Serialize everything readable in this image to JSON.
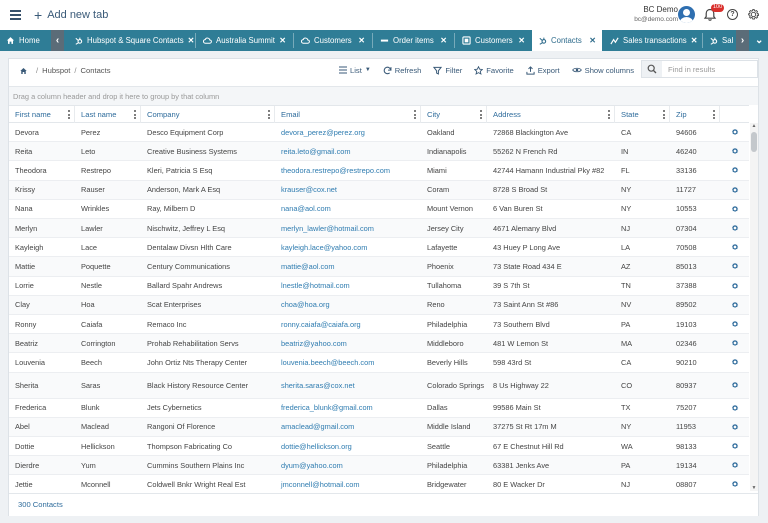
{
  "header": {
    "add_tab_label": "Add new tab",
    "user_name": "BC Demo",
    "user_email": "bc@demo.com",
    "notification_count": "100"
  },
  "tabs": [
    {
      "label": "Home",
      "icon": "home-icon"
    },
    {
      "label": "Hubspot & Square Contacts",
      "icon": "hubspot-icon"
    },
    {
      "label": "Australia Summit",
      "icon": "cloud-icon"
    },
    {
      "label": "Customers",
      "icon": "cloud-icon"
    },
    {
      "label": "Order items",
      "icon": "dash-icon"
    },
    {
      "label": "Customers",
      "icon": "box-icon"
    },
    {
      "label": "Contacts",
      "icon": "hubspot-icon",
      "active": true
    },
    {
      "label": "Sales transactions",
      "icon": "chart-icon"
    },
    {
      "label": "Sal",
      "icon": "hubspot-icon"
    }
  ],
  "breadcrumb": {
    "part1": "Hubspot",
    "part2": "Contacts"
  },
  "toolbar": {
    "list_label": "List",
    "refresh_label": "Refresh",
    "filter_label": "Filter",
    "favorite_label": "Favorite",
    "export_label": "Export",
    "show_columns_label": "Show columns",
    "search_placeholder": "Find in results"
  },
  "group_hint": "Drag a column header and drop it here to group by that column",
  "columns": [
    "First name",
    "Last name",
    "Company",
    "Email",
    "City",
    "Address",
    "State",
    "Zip"
  ],
  "rows": [
    [
      "Devora",
      "Perez",
      "Desco Equipment Corp",
      "devora_perez@perez.org",
      "Oakland",
      "72868 Blackington Ave",
      "CA",
      "94606"
    ],
    [
      "Reita",
      "Leto",
      "Creative Business Systems",
      "reita.leto@gmail.com",
      "Indianapolis",
      "55262 N French Rd",
      "IN",
      "46240"
    ],
    [
      "Theodora",
      "Restrepo",
      "Kleri, Patricia S Esq",
      "theodora.restrepo@restrepo.com",
      "Miami",
      "42744 Hamann Industrial Pky #82",
      "FL",
      "33136"
    ],
    [
      "Krissy",
      "Rauser",
      "Anderson, Mark A Esq",
      "krauser@cox.net",
      "Coram",
      "8728 S Broad St",
      "NY",
      "11727"
    ],
    [
      "Nana",
      "Wrinkles",
      "Ray, Milbern D",
      "nana@aol.com",
      "Mount Vernon",
      "6 Van Buren St",
      "NY",
      "10553"
    ],
    [
      "Merlyn",
      "Lawler",
      "Nischwitz, Jeffrey L Esq",
      "merlyn_lawler@hotmail.com",
      "Jersey City",
      "4671 Alemany Blvd",
      "NJ",
      "07304"
    ],
    [
      "Kayleigh",
      "Lace",
      "Dentalaw Divsn Hlth Care",
      "kayleigh.lace@yahoo.com",
      "Lafayette",
      "43 Huey P Long Ave",
      "LA",
      "70508"
    ],
    [
      "Mattie",
      "Poquette",
      "Century Communications",
      "mattie@aol.com",
      "Phoenix",
      "73 State Road 434 E",
      "AZ",
      "85013"
    ],
    [
      "Lorrie",
      "Nestle",
      "Ballard Spahr Andrews",
      "lnestle@hotmail.com",
      "Tullahoma",
      "39 S 7th St",
      "TN",
      "37388"
    ],
    [
      "Clay",
      "Hoa",
      "Scat Enterprises",
      "choa@hoa.org",
      "Reno",
      "73 Saint Ann St #86",
      "NV",
      "89502"
    ],
    [
      "Ronny",
      "Caiafa",
      "Remaco Inc",
      "ronny.caiafa@caiafa.org",
      "Philadelphia",
      "73 Southern Blvd",
      "PA",
      "19103"
    ],
    [
      "Beatriz",
      "Corrington",
      "Prohab Rehabilitation Servs",
      "beatriz@yahoo.com",
      "Middleboro",
      "481 W Lemon St",
      "MA",
      "02346"
    ],
    [
      "Louvenia",
      "Beech",
      "John Ortiz Nts Therapy Center",
      "louvenia.beech@beech.com",
      "Beverly Hills",
      "598 43rd St",
      "CA",
      "90210"
    ],
    [
      "Sherita",
      "Saras",
      "Black History Resource Center",
      "sherita.saras@cox.net",
      "Colorado Springs",
      "8 Us Highway 22",
      "CO",
      "80937"
    ],
    [
      "Frederica",
      "Blunk",
      "Jets Cybernetics",
      "frederica_blunk@gmail.com",
      "Dallas",
      "99586 Main St",
      "TX",
      "75207"
    ],
    [
      "Abel",
      "Maclead",
      "Rangoni Of Florence",
      "amaclead@gmail.com",
      "Middle Island",
      "37275 St Rt 17m M",
      "NY",
      "11953"
    ],
    [
      "Dottie",
      "Hellickson",
      "Thompson Fabricating Co",
      "dottie@hellickson.org",
      "Seattle",
      "67 E Chestnut Hill Rd",
      "WA",
      "98133"
    ],
    [
      "Dierdre",
      "Yum",
      "Cummins Southern Plains Inc",
      "dyum@yahoo.com",
      "Philadelphia",
      "63381 Jenks Ave",
      "PA",
      "19134"
    ],
    [
      "Jettie",
      "Mconnell",
      "Coldwell Bnkr Wright Real Est",
      "jmconnell@hotmail.com",
      "Bridgewater",
      "80 E Wacker Dr",
      "NJ",
      "08807"
    ]
  ],
  "footer_count": "300 Contacts"
}
